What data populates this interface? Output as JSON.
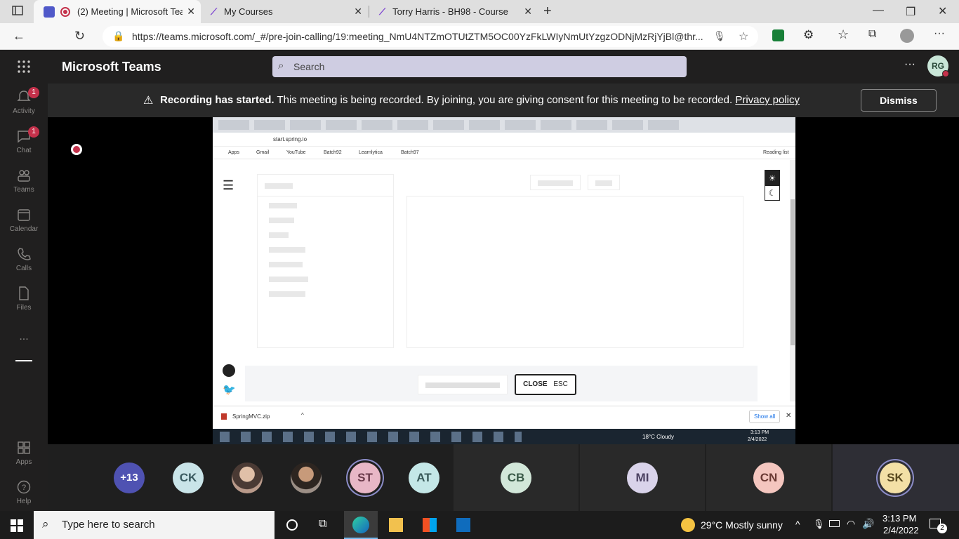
{
  "browser": {
    "tabs": [
      {
        "title": "(2) Meeting | Microsoft Teams",
        "active": true
      },
      {
        "title": "My Courses",
        "active": false
      },
      {
        "title": "Torry Harris - BH98 - Course",
        "active": false
      }
    ],
    "url": "https://teams.microsoft.com/_#/pre-join-calling/19:meeting_NmU4NTZmOTUtZTM5OC00YzFkLWIyNmUtYzgzODNjMzRjYjBl@thr..."
  },
  "teams": {
    "app_name": "Microsoft Teams",
    "search_placeholder": "Search",
    "avatar_initials": "RG",
    "banner": {
      "bold": "Recording has started.",
      "text": " This meeting is being recorded. By joining, you are giving consent for this meeting to be recorded. ",
      "link": "Privacy policy",
      "dismiss": "Dismiss"
    },
    "rail": [
      {
        "label": "Activity",
        "badge": "1"
      },
      {
        "label": "Chat",
        "badge": "1"
      },
      {
        "label": "Teams",
        "badge": ""
      },
      {
        "label": "Calendar",
        "badge": ""
      },
      {
        "label": "Calls",
        "badge": ""
      },
      {
        "label": "Files",
        "badge": ""
      },
      {
        "label": "Apps",
        "badge": ""
      },
      {
        "label": "Help",
        "badge": ""
      }
    ],
    "rail_more": "..."
  },
  "shared_screen": {
    "url": "start.spring.io",
    "bookmarks": [
      "Apps",
      "Gmail",
      "YouTube",
      "Batch92",
      "Learnlytica",
      "Batch97"
    ],
    "reading_list": "Reading list",
    "close_button": "CLOSE",
    "close_key": "ESC",
    "download_file": "SpringMVC.zip",
    "show_all": "Show all",
    "weather": "18°C  Cloudy",
    "time": "3:13 PM",
    "date": "2/4/2022"
  },
  "participants": [
    {
      "initials": "+13",
      "color": "#4f52b2"
    },
    {
      "initials": "CK",
      "color": "#c9e4e8"
    },
    {
      "initials": "",
      "color": "#777777"
    },
    {
      "initials": "",
      "color": "#777777"
    },
    {
      "initials": "ST",
      "color": "#e8b7c6"
    },
    {
      "initials": "AT",
      "color": "#c4e7e7"
    },
    {
      "initials": "CB",
      "color": "#d2e7d9"
    },
    {
      "initials": "MI",
      "color": "#d9d3ea"
    },
    {
      "initials": "CN",
      "color": "#f4c6bf"
    },
    {
      "initials": "SK",
      "color": "#f3e0a6"
    }
  ],
  "taskbar": {
    "search_placeholder": "Type here to search",
    "weather": "29°C  Mostly sunny",
    "time": "3:13 PM",
    "date": "2/4/2022",
    "notifications": "2"
  }
}
